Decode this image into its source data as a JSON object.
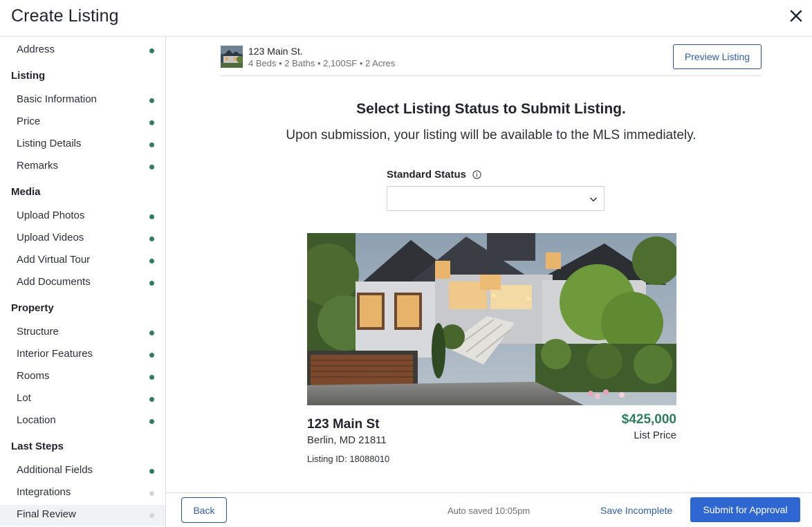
{
  "app": {
    "title": "Create Listing"
  },
  "colors": {
    "complete_dot": "#2e7d5b",
    "pending_dot": "#d3d5d9",
    "accent": "#2e67d1",
    "price": "#2e7d5b"
  },
  "sidebar": {
    "address": {
      "label": "Address",
      "status": "complete"
    },
    "sections": [
      {
        "title": "Listing",
        "items": [
          {
            "label": "Basic Information",
            "status": "complete"
          },
          {
            "label": "Price",
            "status": "complete"
          },
          {
            "label": "Listing Details",
            "status": "complete"
          },
          {
            "label": "Remarks",
            "status": "complete"
          }
        ]
      },
      {
        "title": "Media",
        "items": [
          {
            "label": "Upload Photos",
            "status": "complete"
          },
          {
            "label": "Upload Videos",
            "status": "complete"
          },
          {
            "label": "Add Virtual Tour",
            "status": "complete"
          },
          {
            "label": "Add Documents",
            "status": "complete"
          }
        ]
      },
      {
        "title": "Property",
        "items": [
          {
            "label": "Structure",
            "status": "complete"
          },
          {
            "label": "Interior Features",
            "status": "complete"
          },
          {
            "label": "Rooms",
            "status": "complete"
          },
          {
            "label": "Lot",
            "status": "complete"
          },
          {
            "label": "Location",
            "status": "complete"
          }
        ]
      },
      {
        "title": "Last Steps",
        "items": [
          {
            "label": "Additional Fields",
            "status": "complete"
          },
          {
            "label": "Integrations",
            "status": "pending"
          },
          {
            "label": "Final Review",
            "status": "pending",
            "active": true
          }
        ]
      }
    ]
  },
  "summary": {
    "address": "123 Main St.",
    "meta": "4 Beds • 2 Baths • 2,100SF • 2 Acres",
    "preview_label": "Preview Listing"
  },
  "main": {
    "heading": "Select Listing Status to Submit Listing.",
    "subheading": "Upon submission, your listing will be available to the MLS immediately.",
    "status_label": "Standard Status",
    "status_value": ""
  },
  "listing": {
    "address": "123 Main St",
    "city_line": "Berlin, MD 21811",
    "listing_id": "Listing ID: 18088010",
    "price": "$425,000",
    "price_label": "List Price"
  },
  "footer": {
    "back_label": "Back",
    "autosave": "Auto saved 10:05pm",
    "save_incomplete_label": "Save Incomplete",
    "submit_label": "Submit for Approval"
  }
}
